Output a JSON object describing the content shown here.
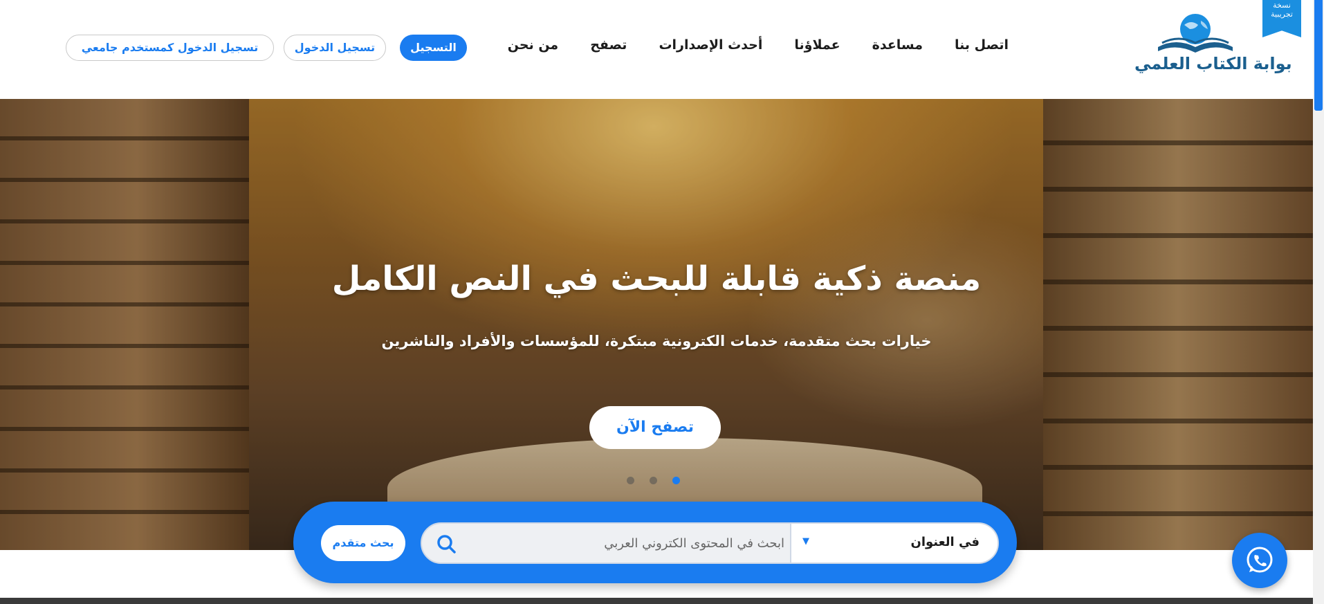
{
  "header": {
    "logo_text": "بوابة الكتاب العلمي",
    "logo_icon": "globe-book-icon",
    "beta_ribbon": "نسخة تجريبية",
    "nav": [
      {
        "label": "من نحن"
      },
      {
        "label": "تصفح"
      },
      {
        "label": "أحدث الإصدارات"
      },
      {
        "label": "عملاؤنا"
      },
      {
        "label": "مساعدة"
      },
      {
        "label": "اتصل بنا"
      }
    ],
    "register_label": "التسجيل",
    "login_label": "تسجيل الدخول",
    "university_login_label": "تسجيل الدخول كمستخدم جامعي"
  },
  "hero": {
    "title": "منصة ذكية قابلة للبحث في النص الكامل",
    "subtitle": "خيارات بحث متقدمة، خدمات الكترونية مبتكرة، للمؤسسات والأفراد والناشرين",
    "browse_label": "تصفح الآن",
    "slides_count": 3,
    "active_slide": 3
  },
  "search": {
    "placeholder": "ابحث في المحتوى الكتروني العربي",
    "scope_selected": "في العنوان",
    "advanced_label": "بحث متقدم",
    "search_icon": "search-icon"
  },
  "floating": {
    "icon": "whatsapp-icon"
  },
  "colors": {
    "accent": "#1a7cf0",
    "brand_dark": "#1b5f8e"
  }
}
